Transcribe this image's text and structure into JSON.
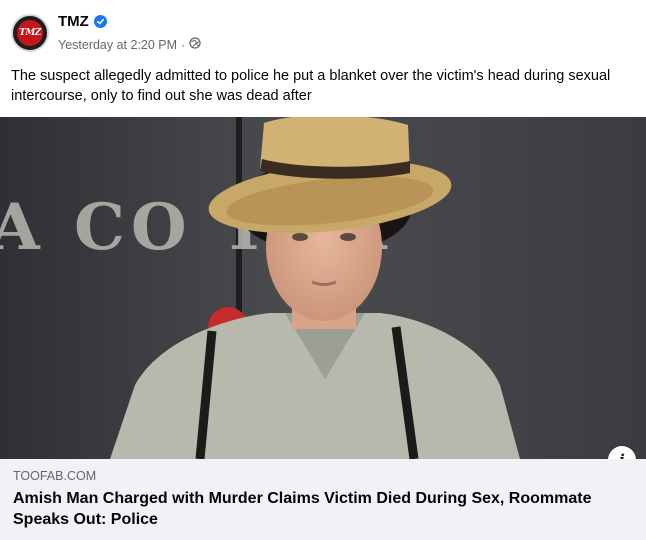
{
  "post": {
    "page_name": "TMZ",
    "avatar_text": "TMZ",
    "timestamp": "Yesterday at 2:20 PM",
    "separator": "·",
    "audience_icon": "globe-icon",
    "verified_icon": "verified-check-icon",
    "caption": "The suspect allegedly admitted to police he put a blanket over the victim's head during sexual intercourse, only to find out she was dead after"
  },
  "photo": {
    "wall_text": "A CO     Y JA"
  },
  "link_preview": {
    "domain": "TOOFAB.COM",
    "headline": "Amish Man Charged with Murder Claims Victim Died During Sex, Roommate Speaks Out: Police",
    "info_label": "i"
  },
  "colors": {
    "accent": "#1877f2",
    "secondary_text": "#65676b",
    "link_background": "#f0f2f5",
    "brand_red": "#c4161c"
  }
}
